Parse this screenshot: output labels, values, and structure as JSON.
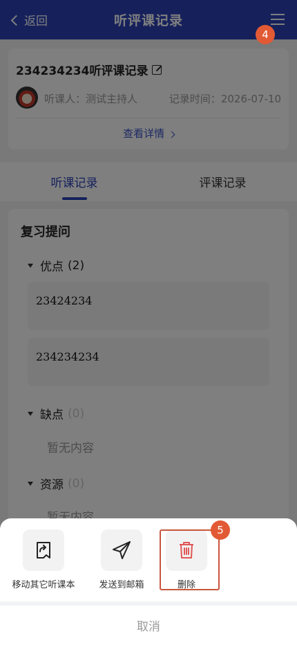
{
  "header": {
    "back_label": "返回",
    "title": "听评课记录"
  },
  "badges": {
    "menu_badge": "4",
    "delete_badge": "5"
  },
  "card": {
    "title": "234234234听评课记录",
    "listener_label": "听课人：",
    "listener_name": "测试主持人",
    "record_time_label": "记录时间：",
    "record_time": "2026-07-10",
    "detail_link": "查看详情"
  },
  "tabs": [
    {
      "label": "听课记录",
      "active": true
    },
    {
      "label": "评课记录",
      "active": false
    }
  ],
  "section": {
    "title": "复习提问",
    "groups": [
      {
        "label": "优点",
        "count": "(2)",
        "items": [
          "23424234",
          "234234234"
        ]
      },
      {
        "label": "缺点",
        "count": "(0)",
        "empty_text": "暂无内容"
      },
      {
        "label": "资源",
        "count": "(0)",
        "empty_text": "暂无内容"
      }
    ]
  },
  "action_sheet": {
    "actions": [
      {
        "label": "移动其它听课本",
        "icon": "move-notebook-icon"
      },
      {
        "label": "发送到邮箱",
        "icon": "send-paper-plane-icon"
      },
      {
        "label": "删除",
        "icon": "trash-icon"
      }
    ],
    "cancel_label": "取消"
  },
  "colors": {
    "primary": "#2c43b8",
    "badge": "#e25a35",
    "delete_red": "#e05555",
    "highlight_border": "#c8553b"
  }
}
